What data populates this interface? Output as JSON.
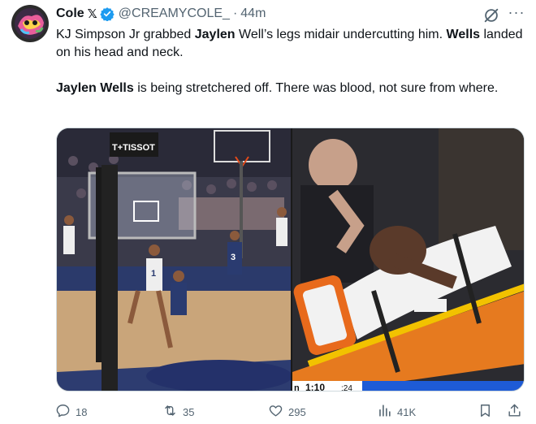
{
  "tweet": {
    "author_name": "Cole",
    "author_x_mark": "𝕏",
    "handle": "@CREAMYCOLE_",
    "separator": "·",
    "time": "44m",
    "more_label": "···",
    "paragraph1": [
      {
        "text": "KJ Simpson Jr grabbed ",
        "bold": false
      },
      {
        "text": "Jaylen",
        "bold": true
      },
      {
        "text": " Well’s legs midair undercutting him. ",
        "bold": false
      },
      {
        "text": "Wells",
        "bold": true
      },
      {
        "text": " landed on his head and neck.",
        "bold": false
      }
    ],
    "paragraph2": [
      {
        "text": "Jaylen Wells",
        "bold": true
      },
      {
        "text": " is being stretchered off. There was blood, not sure from where.",
        "bold": false
      }
    ]
  },
  "media": {
    "left_image": {
      "description_icon": "basketball-play-image",
      "scoreboard_text": "T+TISSOT",
      "jersey_numbers": [
        "1",
        "3"
      ]
    },
    "right_image": {
      "description_icon": "stretcher-image",
      "game_clock": "1:10",
      "shot_clock": ":24",
      "period_prefix": "n"
    }
  },
  "actions": {
    "reply_count": "18",
    "retweet_count": "35",
    "like_count": "295",
    "views_count": "41K"
  },
  "colors": {
    "text_primary": "#0f1419",
    "text_secondary": "#536471",
    "verified_blue": "#1d9bf0",
    "border": "#cfd9de"
  }
}
